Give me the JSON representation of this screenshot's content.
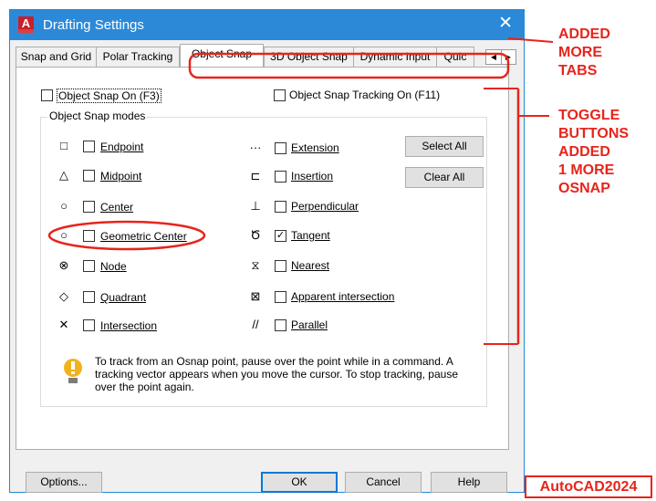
{
  "window": {
    "title": "Drafting Settings",
    "app_icon_letter": "A",
    "close_glyph": "✕"
  },
  "tabs": [
    {
      "label": "Snap and Grid"
    },
    {
      "label": "Polar Tracking"
    },
    {
      "label": "Object Snap",
      "active": true
    },
    {
      "label": "3D Object Snap"
    },
    {
      "label": "Dynamic Input"
    },
    {
      "label": "Quic"
    }
  ],
  "tab_scroll": {
    "left": "◀",
    "right": "▶"
  },
  "top_options": {
    "osnap_on": {
      "label": "Object Snap On (F3)",
      "checked": false
    },
    "tracking_on": {
      "label": "Object Snap Tracking On (F11)",
      "checked": false
    }
  },
  "group_label": "Object Snap modes",
  "left_modes": [
    {
      "label": "Endpoint",
      "symbol": "□",
      "checked": false
    },
    {
      "label": "Midpoint",
      "symbol": "△",
      "checked": false
    },
    {
      "label": "Center",
      "symbol": "○",
      "checked": false
    },
    {
      "label": "Geometric Center",
      "symbol": "○",
      "checked": false
    },
    {
      "label": "Node",
      "symbol": "⊗",
      "checked": false
    },
    {
      "label": "Quadrant",
      "symbol": "◇",
      "checked": false
    },
    {
      "label": "Intersection",
      "symbol": "✕",
      "checked": false
    }
  ],
  "right_modes": [
    {
      "label": "Extension",
      "symbol": "···",
      "checked": false
    },
    {
      "label": "Insertion",
      "symbol": "⊏",
      "checked": false
    },
    {
      "label": "Perpendicular",
      "symbol": "⊥",
      "checked": false
    },
    {
      "label": "Tangent",
      "symbol": "Ծ",
      "checked": true
    },
    {
      "label": "Nearest",
      "symbol": "⧖",
      "checked": false
    },
    {
      "label": "Apparent intersection",
      "symbol": "⊠",
      "checked": false
    },
    {
      "label": "Parallel",
      "symbol": "//",
      "checked": false
    }
  ],
  "select_all": "Select All",
  "clear_all": "Clear All",
  "info_text": "To track from an Osnap point, pause over the point while in a command.  A tracking vector appears when you move the cursor.  To stop tracking, pause over the point again.",
  "footer": {
    "options": "Options...",
    "ok": "OK",
    "cancel": "Cancel",
    "help": "Help"
  },
  "annotations": {
    "tabs_note": [
      "ADDED",
      "MORE",
      "TABS"
    ],
    "toggle_note": [
      "TOGGLE",
      "BUTTONS",
      "ADDED",
      "1 MORE",
      "OSNAP"
    ],
    "version": "AutoCAD2024"
  },
  "colors": {
    "titlebar": "#2b89d8",
    "annotation_red": "#e8241b",
    "hint_bulb": "#f2b21b"
  }
}
